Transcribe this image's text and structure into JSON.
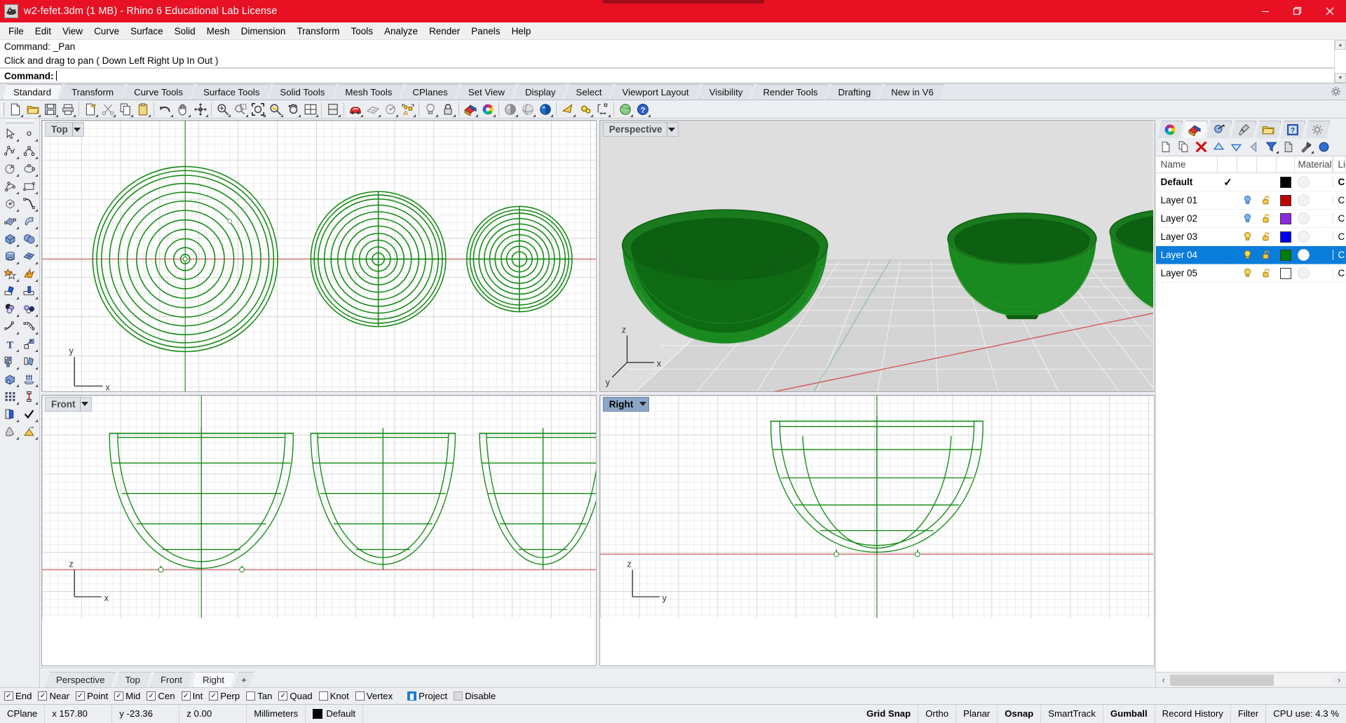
{
  "window": {
    "title": "w2-fefet.3dm (1 MB) - Rhino 6 Educational Lab License",
    "icon_name": "rhino-app-icon",
    "minimize": "—",
    "maximize": "❐",
    "close": "✕",
    "titlebar_color": "#e81123"
  },
  "menu": {
    "items": [
      "File",
      "Edit",
      "View",
      "Curve",
      "Surface",
      "Solid",
      "Mesh",
      "Dimension",
      "Transform",
      "Tools",
      "Analyze",
      "Render",
      "Panels",
      "Help"
    ]
  },
  "command": {
    "history_1": "Command: _Pan",
    "history_2": "Click and drag to pan ( Down  Left  Right  Up  In  Out )",
    "prompt_label": "Command:",
    "input_value": "",
    "scroll_up": "▲",
    "scroll_down": "▼"
  },
  "ribbon": {
    "tabs": [
      {
        "label": "Standard",
        "active": true
      },
      {
        "label": "Transform",
        "active": false
      },
      {
        "label": "Curve Tools",
        "active": false
      },
      {
        "label": "Surface Tools",
        "active": false
      },
      {
        "label": "Solid Tools",
        "active": false
      },
      {
        "label": "Mesh Tools",
        "active": false
      },
      {
        "label": "CPlanes",
        "active": false
      },
      {
        "label": "Set View",
        "active": false
      },
      {
        "label": "Display",
        "active": false
      },
      {
        "label": "Select",
        "active": false
      },
      {
        "label": "Viewport Layout",
        "active": false
      },
      {
        "label": "Visibility",
        "active": false
      },
      {
        "label": "Render Tools",
        "active": false
      },
      {
        "label": "Drafting",
        "active": false
      },
      {
        "label": "New in V6",
        "active": false
      }
    ],
    "options_icon": "gear-icon"
  },
  "toolbar": {
    "buttons": [
      {
        "name": "new-file-icon",
        "glyph": "doc"
      },
      {
        "name": "open-file-icon",
        "glyph": "folder"
      },
      {
        "name": "save-file-icon",
        "glyph": "floppy"
      },
      {
        "name": "print-icon",
        "glyph": "printer"
      },
      {
        "name": "cut-selection-icon",
        "glyph": "docarrow"
      },
      {
        "name": "scissors-cut-icon",
        "glyph": "scissors"
      },
      {
        "name": "copy-icon",
        "glyph": "copy"
      },
      {
        "name": "paste-icon",
        "glyph": "clipboard"
      },
      {
        "name": "undo-icon",
        "glyph": "undo"
      },
      {
        "name": "pan-hand-icon",
        "glyph": "hand"
      },
      {
        "name": "rotate-view-icon",
        "glyph": "orbit"
      },
      {
        "name": "zoom-in-icon",
        "glyph": "zoomplus"
      },
      {
        "name": "zoom-window-icon",
        "glyph": "zoomwin"
      },
      {
        "name": "zoom-extents-icon",
        "glyph": "zoomext"
      },
      {
        "name": "zoom-selected-icon",
        "glyph": "zoomsel"
      },
      {
        "name": "zoom-previous-icon",
        "glyph": "zoomprev"
      },
      {
        "name": "viewport-layout-icon",
        "glyph": "vplayout"
      },
      {
        "name": "split-viewport-icon",
        "glyph": "splitvp"
      },
      {
        "name": "render-car-icon",
        "glyph": "car"
      },
      {
        "name": "grid-plane-icon",
        "glyph": "gridplane"
      },
      {
        "name": "named-cplane-icon",
        "glyph": "cplane"
      },
      {
        "name": "point-object-icon",
        "glyph": "pointobj"
      },
      {
        "name": "light-bulb-icon",
        "glyph": "bulb"
      },
      {
        "name": "lock-object-icon",
        "glyph": "lock"
      },
      {
        "name": "layers-icon",
        "glyph": "layers"
      },
      {
        "name": "color-wheel-icon",
        "glyph": "colorwheel"
      },
      {
        "name": "shaded-display-icon",
        "glyph": "sphere-grey"
      },
      {
        "name": "ghosted-display-icon",
        "glyph": "sphere-ghost"
      },
      {
        "name": "rendered-display-icon",
        "glyph": "sphere-blue"
      },
      {
        "name": "render-preview-icon",
        "glyph": "rendertri"
      },
      {
        "name": "render-settings-icon",
        "glyph": "gears"
      },
      {
        "name": "dimension-icon",
        "glyph": "dimension"
      },
      {
        "name": "globe-icon",
        "glyph": "globe"
      },
      {
        "name": "help-icon",
        "glyph": "help"
      }
    ]
  },
  "left_toolbar": {
    "rows": [
      [
        {
          "name": "select-arrow-icon"
        },
        {
          "name": "point-icon"
        }
      ],
      [
        {
          "name": "polyline-icon"
        },
        {
          "name": "curve-control-points-icon"
        }
      ],
      [
        {
          "name": "circle-icon"
        },
        {
          "name": "ellipse-icon"
        }
      ],
      [
        {
          "name": "arc-icon"
        },
        {
          "name": "rectangle-icon"
        }
      ],
      [
        {
          "name": "polygon-icon"
        },
        {
          "name": "curve-blend-icon"
        }
      ],
      [
        {
          "name": "surface-from-points-icon"
        },
        {
          "name": "surface-extrude-icon"
        }
      ],
      [
        {
          "name": "box-solid-icon"
        },
        {
          "name": "sphere-solid-icon"
        }
      ],
      [
        {
          "name": "cylinder-solid-icon"
        },
        {
          "name": "surface-from-curves-icon"
        }
      ],
      [
        {
          "name": "boolean-union-icon"
        },
        {
          "name": "explode-icon"
        }
      ],
      [
        {
          "name": "trim-icon"
        },
        {
          "name": "split-icon"
        }
      ],
      [
        {
          "name": "fillet-surface-icon"
        },
        {
          "name": "offset-icon"
        }
      ],
      [
        {
          "name": "curve-fillet-icon"
        },
        {
          "name": "curve-offset-icon"
        }
      ],
      [
        {
          "name": "text-tool-icon"
        },
        {
          "name": "scale-icon"
        }
      ],
      [
        {
          "name": "array-icon"
        },
        {
          "name": "mirror-icon"
        }
      ],
      [
        {
          "name": "extrude-solid-icon"
        },
        {
          "name": "extrude-multiple-icon"
        }
      ],
      [
        {
          "name": "grid-array-icon"
        },
        {
          "name": "dimension-linear-icon"
        }
      ],
      [
        {
          "name": "page-layout-icon"
        },
        {
          "name": "check-mark-icon"
        }
      ],
      [
        {
          "name": "cone-icon"
        },
        {
          "name": "render-paint-icon"
        }
      ]
    ]
  },
  "viewports": [
    {
      "name": "top-viewport",
      "label": "Top",
      "active": false,
      "axes": {
        "h": "x",
        "v": "y"
      },
      "objects": "three concentric-ring bowl profiles viewed from above"
    },
    {
      "name": "perspective-viewport",
      "label": "Perspective",
      "active": false,
      "axes": {
        "h": "x",
        "v": "z",
        "d": "y"
      },
      "objects": "three shaded green bowls on a ground grid"
    },
    {
      "name": "front-viewport",
      "label": "Front",
      "active": false,
      "axes": {
        "h": "x",
        "v": "z"
      },
      "objects": "three bowl wireframe elevations"
    },
    {
      "name": "right-viewport",
      "label": "Right",
      "active": true,
      "axes": {
        "h": "y",
        "v": "z"
      },
      "objects": "single large bowl wireframe elevation"
    }
  ],
  "viewport_tabs": [
    {
      "label": "Perspective",
      "active": false
    },
    {
      "label": "Top",
      "active": false
    },
    {
      "label": "Front",
      "active": false
    },
    {
      "label": "Right",
      "active": true
    },
    {
      "label": "+",
      "active": false
    }
  ],
  "panel": {
    "tabs": [
      {
        "name": "color-wheel-tab-icon",
        "active": false
      },
      {
        "name": "layers-tab-icon",
        "active": true
      },
      {
        "name": "object-properties-tab-icon",
        "active": false
      },
      {
        "name": "display-tab-icon",
        "active": false
      },
      {
        "name": "named-views-tab-icon",
        "active": false
      },
      {
        "name": "help-tab-icon",
        "active": false
      },
      {
        "name": "panel-options-gear-icon",
        "active": false
      }
    ],
    "toolbar_buttons": [
      {
        "name": "new-layer-icon"
      },
      {
        "name": "duplicate-layer-icon"
      },
      {
        "name": "delete-layer-icon"
      },
      {
        "name": "move-layer-up-icon"
      },
      {
        "name": "move-layer-down-icon"
      },
      {
        "name": "previous-layer-icon"
      },
      {
        "name": "filter-layers-icon"
      },
      {
        "name": "layer-properties-icon"
      },
      {
        "name": "layer-tools-icon"
      },
      {
        "name": "select-objects-icon"
      }
    ],
    "columns": [
      "Name",
      "",
      "",
      "",
      "",
      "Material",
      "Li"
    ],
    "layers": [
      {
        "name": "Default",
        "current": true,
        "bold": true,
        "selected": false,
        "visible_icon": "",
        "lock_icon": "",
        "color": "#000000",
        "material_on": false,
        "linetype": "C"
      },
      {
        "name": "Layer 01",
        "current": false,
        "bold": false,
        "selected": false,
        "visible_icon": "bulb-on-blue",
        "lock_icon": "unlocked",
        "color": "#c00000",
        "material_on": false,
        "linetype": "C"
      },
      {
        "name": "Layer 02",
        "current": false,
        "bold": false,
        "selected": false,
        "visible_icon": "bulb-on-blue",
        "lock_icon": "unlocked",
        "color": "#8a2be2",
        "material_on": false,
        "linetype": "C"
      },
      {
        "name": "Layer 03",
        "current": false,
        "bold": false,
        "selected": false,
        "visible_icon": "bulb-on",
        "lock_icon": "unlocked",
        "color": "#0000ee",
        "material_on": false,
        "linetype": "C"
      },
      {
        "name": "Layer 04",
        "current": false,
        "bold": false,
        "selected": true,
        "visible_icon": "bulb-on",
        "lock_icon": "unlocked",
        "color": "#008000",
        "material_on": true,
        "linetype": "C"
      },
      {
        "name": "Layer 05",
        "current": false,
        "bold": false,
        "selected": false,
        "visible_icon": "bulb-on",
        "lock_icon": "unlocked",
        "color": "#ffffff",
        "material_on": false,
        "linetype": "C"
      }
    ],
    "current_check": "✓",
    "hscroll_left": "‹",
    "hscroll_right": "›"
  },
  "osnap": {
    "items": [
      {
        "label": "End",
        "checked": true,
        "state": "checked"
      },
      {
        "label": "Near",
        "checked": true,
        "state": "checked"
      },
      {
        "label": "Point",
        "checked": true,
        "state": "checked"
      },
      {
        "label": "Mid",
        "checked": true,
        "state": "checked"
      },
      {
        "label": "Cen",
        "checked": true,
        "state": "checked"
      },
      {
        "label": "Int",
        "checked": true,
        "state": "checked"
      },
      {
        "label": "Perp",
        "checked": true,
        "state": "checked"
      },
      {
        "label": "Tan",
        "checked": false,
        "state": "unchecked"
      },
      {
        "label": "Quad",
        "checked": true,
        "state": "checked"
      },
      {
        "label": "Knot",
        "checked": false,
        "state": "unchecked"
      },
      {
        "label": "Vertex",
        "checked": false,
        "state": "unchecked"
      },
      {
        "label": "Project",
        "checked": true,
        "state": "project"
      },
      {
        "label": "Disable",
        "checked": false,
        "state": "disabled"
      }
    ],
    "check_glyph": "✓"
  },
  "status": {
    "cplane": "CPlane",
    "x": "x 157.80",
    "y": "y -23.36",
    "z": "z 0.00",
    "units": "Millimeters",
    "layer": "Default",
    "layer_color": "#000000",
    "toggles": [
      {
        "label": "Grid Snap",
        "on": true
      },
      {
        "label": "Ortho",
        "on": false
      },
      {
        "label": "Planar",
        "on": false
      },
      {
        "label": "Osnap",
        "on": true
      },
      {
        "label": "SmartTrack",
        "on": false
      },
      {
        "label": "Gumball",
        "on": true
      },
      {
        "label": "Record History",
        "on": false
      },
      {
        "label": "Filter",
        "on": false
      }
    ],
    "cpu": "CPU use: 4.3 %"
  }
}
